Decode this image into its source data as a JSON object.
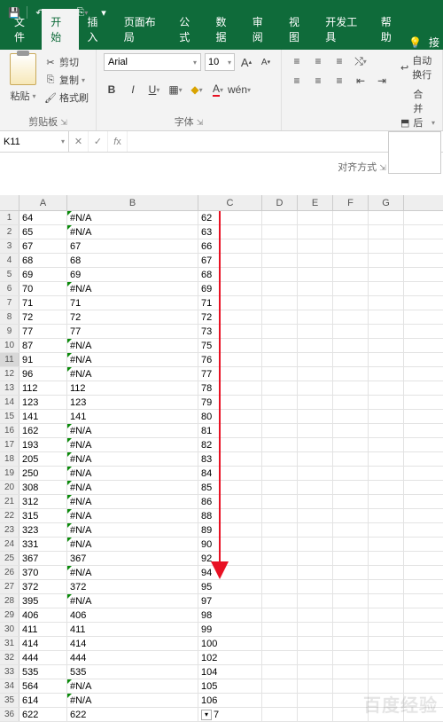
{
  "qat": {
    "save": "💾",
    "undo": "↶",
    "redo": "↷",
    "more": "▾"
  },
  "tabs": {
    "file": "文件",
    "home": "开始",
    "insert": "插入",
    "layout": "页面布局",
    "formulas": "公式",
    "data": "数据",
    "review": "审阅",
    "view": "视图",
    "dev": "开发工具",
    "help": "帮助",
    "ext": "接"
  },
  "clipboard": {
    "paste": "粘贴",
    "cut": "剪切",
    "copy": "复制",
    "format_painter": "格式刷",
    "group_label": "剪贴板"
  },
  "font": {
    "name": "Arial",
    "size": "10",
    "group_label": "字体",
    "inc": "A",
    "dec": "A"
  },
  "alignment": {
    "wrap": "自动换行",
    "merge": "合并后居中",
    "group_label": "对齐方式"
  },
  "namebox": "K11",
  "columns": [
    "A",
    "B",
    "C",
    "D",
    "E",
    "F",
    "G"
  ],
  "rows": [
    {
      "n": 1,
      "a": "64",
      "b": "#N/A",
      "c": "62"
    },
    {
      "n": 2,
      "a": "65",
      "b": "#N/A",
      "c": "63"
    },
    {
      "n": 3,
      "a": "67",
      "b": "67",
      "c": "66"
    },
    {
      "n": 4,
      "a": "68",
      "b": "68",
      "c": "67"
    },
    {
      "n": 5,
      "a": "69",
      "b": "69",
      "c": "68"
    },
    {
      "n": 6,
      "a": "70",
      "b": "#N/A",
      "c": "69"
    },
    {
      "n": 7,
      "a": "71",
      "b": "71",
      "c": "71"
    },
    {
      "n": 8,
      "a": "72",
      "b": "72",
      "c": "72"
    },
    {
      "n": 9,
      "a": "77",
      "b": "77",
      "c": "73"
    },
    {
      "n": 10,
      "a": "87",
      "b": "#N/A",
      "c": "75"
    },
    {
      "n": 11,
      "a": "91",
      "b": "#N/A",
      "c": "76",
      "sel": true
    },
    {
      "n": 12,
      "a": "96",
      "b": "#N/A",
      "c": "77"
    },
    {
      "n": 13,
      "a": "112",
      "b": "112",
      "c": "78"
    },
    {
      "n": 14,
      "a": "123",
      "b": "123",
      "c": "79"
    },
    {
      "n": 15,
      "a": "141",
      "b": "141",
      "c": "80"
    },
    {
      "n": 16,
      "a": "162",
      "b": "#N/A",
      "c": "81"
    },
    {
      "n": 17,
      "a": "193",
      "b": "#N/A",
      "c": "82"
    },
    {
      "n": 18,
      "a": "205",
      "b": "#N/A",
      "c": "83"
    },
    {
      "n": 19,
      "a": "250",
      "b": "#N/A",
      "c": "84"
    },
    {
      "n": 20,
      "a": "308",
      "b": "#N/A",
      "c": "85"
    },
    {
      "n": 21,
      "a": "312",
      "b": "#N/A",
      "c": "86"
    },
    {
      "n": 22,
      "a": "315",
      "b": "#N/A",
      "c": "88"
    },
    {
      "n": 23,
      "a": "323",
      "b": "#N/A",
      "c": "89"
    },
    {
      "n": 24,
      "a": "331",
      "b": "#N/A",
      "c": "90"
    },
    {
      "n": 25,
      "a": "367",
      "b": "367",
      "c": "92"
    },
    {
      "n": 26,
      "a": "370",
      "b": "#N/A",
      "c": "94"
    },
    {
      "n": 27,
      "a": "372",
      "b": "372",
      "c": "95"
    },
    {
      "n": 28,
      "a": "395",
      "b": "#N/A",
      "c": "97"
    },
    {
      "n": 29,
      "a": "406",
      "b": "406",
      "c": "98"
    },
    {
      "n": 30,
      "a": "411",
      "b": "411",
      "c": "99"
    },
    {
      "n": 31,
      "a": "414",
      "b": "414",
      "c": "100"
    },
    {
      "n": 32,
      "a": "444",
      "b": "444",
      "c": "102"
    },
    {
      "n": 33,
      "a": "535",
      "b": "535",
      "c": "104"
    },
    {
      "n": 34,
      "a": "564",
      "b": "#N/A",
      "c": "105"
    },
    {
      "n": 35,
      "a": "614",
      "b": "#N/A",
      "c": "106"
    },
    {
      "n": 36,
      "a": "622",
      "b": "622",
      "c": "7",
      "last": true
    }
  ],
  "watermark": "百度经验"
}
